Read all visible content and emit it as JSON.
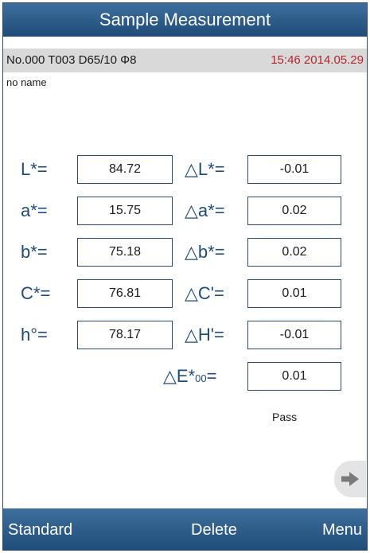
{
  "header": {
    "title": "Sample Measurement"
  },
  "status": {
    "info": "No.000  T003  D65/10   Φ8",
    "datetime": "15:46  2014.05.29"
  },
  "sample": {
    "name": "no name"
  },
  "measurements": {
    "L": {
      "label": "L*=",
      "value": "84.72"
    },
    "a": {
      "label": "a*=",
      "value": "15.75"
    },
    "b": {
      "label": "b*=",
      "value": "75.18"
    },
    "C": {
      "label": "C*=",
      "value": "76.81"
    },
    "h": {
      "label": "h°=",
      "value": "78.17"
    }
  },
  "differences": {
    "dL": {
      "label": "△L*=",
      "value": "-0.01"
    },
    "da": {
      "label": "△a*=",
      "value": "0.02"
    },
    "db": {
      "label": "△b*=",
      "value": "0.02"
    },
    "dC": {
      "label": "△C'=",
      "value": "0.01"
    },
    "dH": {
      "label": "△H'=",
      "value": "-0.01"
    },
    "dE": {
      "label_main": "△E*",
      "label_sub": "00",
      "label_eq": "=",
      "value": "0.01"
    }
  },
  "result": {
    "text": "Pass"
  },
  "navigation": {
    "next_icon": "right-arrow-icon"
  },
  "bottom_bar": {
    "standard": "Standard",
    "delete": "Delete",
    "menu": "Menu"
  },
  "colors": {
    "bar_blue": "#1f4b78",
    "label_blue": "#1f4b78",
    "datetime_red": "#b3262c",
    "status_gray": "#d9d9d9"
  }
}
